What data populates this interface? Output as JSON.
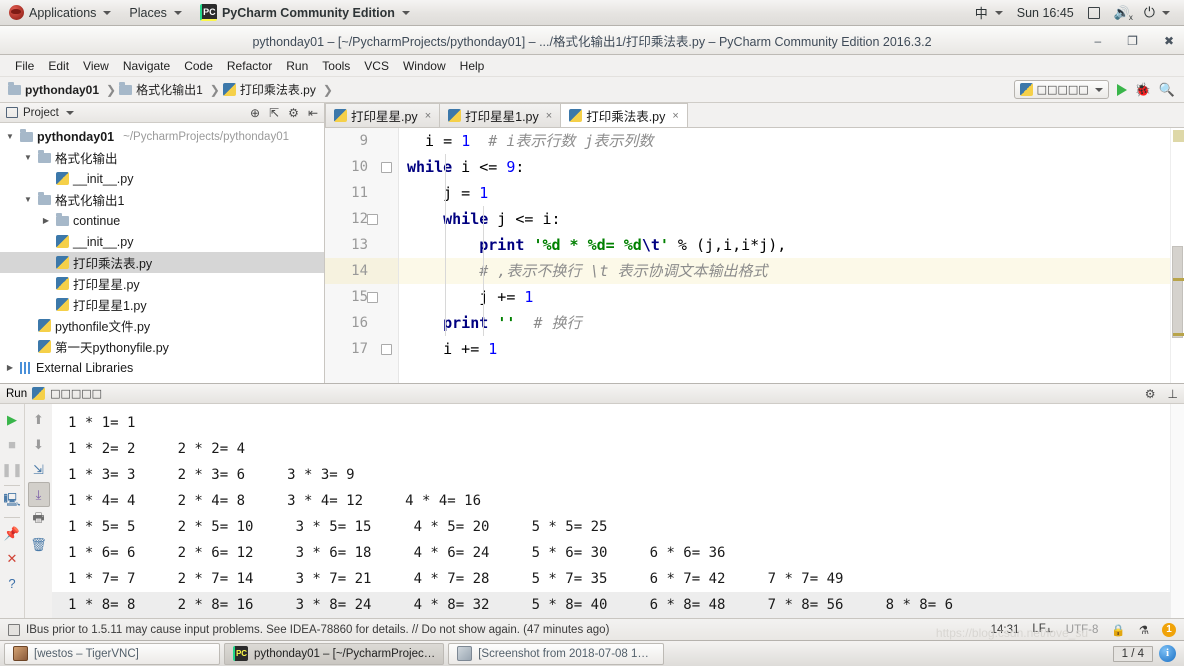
{
  "gnome_panel": {
    "applications": "Applications",
    "places": "Places",
    "app_name": "PyCharm Community Edition",
    "ime": "中",
    "clock": "Sun 16:45"
  },
  "window": {
    "title": "pythonday01 – [~/PycharmProjects/pythonday01] – .../格式化输出1/打印乘法表.py – PyCharm Community Edition 2016.3.2",
    "minimize": "–",
    "maximize": "❐",
    "close": "✖"
  },
  "menubar": {
    "items": [
      "File",
      "Edit",
      "View",
      "Navigate",
      "Code",
      "Refactor",
      "Run",
      "Tools",
      "VCS",
      "Window",
      "Help"
    ]
  },
  "navbar": {
    "breadcrumbs": [
      {
        "label": "pythonday01",
        "icon": "folder-icon"
      },
      {
        "label": "格式化输出1",
        "icon": "folder-icon"
      },
      {
        "label": "打印乘法表.py",
        "icon": "python-file-icon"
      }
    ],
    "run_config": "□□□□□",
    "run_button": "run-icon",
    "debug_button": "debug-icon",
    "search_button": "search-icon"
  },
  "sidebar": {
    "header": "Project",
    "tree": [
      {
        "label": "pythonday01",
        "path": "~/PycharmProjects/pythonday01",
        "icon": "folder-icon",
        "arrow": "▼",
        "indent": 0,
        "bold": true,
        "selected": false
      },
      {
        "label": "格式化输出",
        "path": "",
        "icon": "folder-icon",
        "arrow": "▼",
        "indent": 1,
        "bold": false,
        "selected": false
      },
      {
        "label": "__init__.py",
        "path": "",
        "icon": "python-file-icon",
        "arrow": "",
        "indent": 2,
        "bold": false,
        "selected": false
      },
      {
        "label": "格式化输出1",
        "path": "",
        "icon": "folder-icon",
        "arrow": "▼",
        "indent": 1,
        "bold": false,
        "selected": false
      },
      {
        "label": "continue",
        "path": "",
        "icon": "folder-icon",
        "arrow": "▶",
        "indent": 2,
        "bold": false,
        "selected": false
      },
      {
        "label": "__init__.py",
        "path": "",
        "icon": "python-file-icon",
        "arrow": "",
        "indent": 2,
        "bold": false,
        "selected": false
      },
      {
        "label": "打印乘法表.py",
        "path": "",
        "icon": "python-file-icon",
        "arrow": "",
        "indent": 2,
        "bold": false,
        "selected": true
      },
      {
        "label": "打印星星.py",
        "path": "",
        "icon": "python-file-icon",
        "arrow": "",
        "indent": 2,
        "bold": false,
        "selected": false
      },
      {
        "label": "打印星星1.py",
        "path": "",
        "icon": "python-file-icon",
        "arrow": "",
        "indent": 2,
        "bold": false,
        "selected": false
      },
      {
        "label": "pythonfile文件.py",
        "path": "",
        "icon": "python-file-icon",
        "arrow": "",
        "indent": 1,
        "bold": false,
        "selected": false
      },
      {
        "label": "第一天pythonyfile.py",
        "path": "",
        "icon": "python-file-icon",
        "arrow": "",
        "indent": 1,
        "bold": false,
        "selected": false
      },
      {
        "label": "External Libraries",
        "path": "",
        "icon": "library-icon",
        "arrow": "▶",
        "indent": 0,
        "bold": false,
        "selected": false
      }
    ]
  },
  "editor": {
    "tabs": [
      {
        "label": "打印星星.py",
        "active": false,
        "close": "×"
      },
      {
        "label": "打印星星1.py",
        "active": false,
        "close": "×"
      },
      {
        "label": "打印乘法表.py",
        "active": true,
        "close": "×"
      }
    ],
    "line_numbers": [
      "9",
      "10",
      "11",
      "12",
      "13",
      "14",
      "15",
      "16",
      "17"
    ],
    "code": [
      {
        "n": "9",
        "highlight": false,
        "tokens": [
          {
            "t": "  i = ",
            "c": ""
          },
          {
            "t": "1",
            "c": "num"
          },
          {
            "t": "  ",
            "c": ""
          },
          {
            "t": "# i表示行数 j表示列数",
            "c": "cmt"
          }
        ]
      },
      {
        "n": "10",
        "highlight": false,
        "tokens": [
          {
            "t": "while",
            "c": "kw"
          },
          {
            "t": " i <= ",
            "c": ""
          },
          {
            "t": "9",
            "c": "num"
          },
          {
            "t": ":",
            "c": ""
          }
        ]
      },
      {
        "n": "11",
        "highlight": false,
        "tokens": [
          {
            "t": "    j = ",
            "c": ""
          },
          {
            "t": "1",
            "c": "num"
          }
        ]
      },
      {
        "n": "12",
        "highlight": false,
        "tokens": [
          {
            "t": "    ",
            "c": ""
          },
          {
            "t": "while",
            "c": "kw"
          },
          {
            "t": " j <= i:",
            "c": ""
          }
        ]
      },
      {
        "n": "13",
        "highlight": false,
        "tokens": [
          {
            "t": "        ",
            "c": ""
          },
          {
            "t": "print",
            "c": "kw"
          },
          {
            "t": " ",
            "c": ""
          },
          {
            "t": "'%d * %d= %d",
            "c": "str"
          },
          {
            "t": "\\t",
            "c": "esc"
          },
          {
            "t": "'",
            "c": "str"
          },
          {
            "t": " % (j,i,i*j),",
            "c": ""
          }
        ]
      },
      {
        "n": "14",
        "highlight": true,
        "tokens": [
          {
            "t": "        ",
            "c": ""
          },
          {
            "t": "# ,表示不换行 \\t 表示协调文本输出格式",
            "c": "cmt"
          }
        ]
      },
      {
        "n": "15",
        "highlight": false,
        "tokens": [
          {
            "t": "        j += ",
            "c": ""
          },
          {
            "t": "1",
            "c": "num"
          }
        ]
      },
      {
        "n": "16",
        "highlight": false,
        "tokens": [
          {
            "t": "    ",
            "c": ""
          },
          {
            "t": "print",
            "c": "kw"
          },
          {
            "t": " ",
            "c": ""
          },
          {
            "t": "''",
            "c": "str"
          },
          {
            "t": "  ",
            "c": ""
          },
          {
            "t": "# 换行",
            "c": "cmt"
          }
        ]
      },
      {
        "n": "17",
        "highlight": false,
        "tokens": [
          {
            "t": "    i += ",
            "c": ""
          },
          {
            "t": "1",
            "c": "num"
          }
        ]
      }
    ]
  },
  "run_panel": {
    "tab_label": "Run",
    "tab_config": "□□□□□",
    "settings_icon": "gear-icon",
    "pin_icon": "minimize-icon",
    "tools_left": [
      "run-icon",
      "stop-icon",
      "pause-icon",
      "rerun-icon",
      "pin-icon",
      "close-icon",
      "help-icon"
    ],
    "tools_right": [
      "scroll-up-icon",
      "scroll-down-icon",
      "soft-wrap-icon",
      "scroll-to-end-icon",
      "print-icon",
      "clear-all-icon"
    ],
    "console_lines": [
      "1 * 1= 1",
      "1 * 2= 2     2 * 2= 4",
      "1 * 3= 3     2 * 3= 6     3 * 3= 9",
      "1 * 4= 4     2 * 4= 8     3 * 4= 12     4 * 4= 16",
      "1 * 5= 5     2 * 5= 10     3 * 5= 15     4 * 5= 20     5 * 5= 25",
      "1 * 6= 6     2 * 6= 12     3 * 6= 18     4 * 6= 24     5 * 6= 30     6 * 6= 36",
      "1 * 7= 7     2 * 7= 14     3 * 7= 21     4 * 7= 28     5 * 7= 35     6 * 7= 42     7 * 7= 49",
      "1 * 8= 8     2 * 8= 16     3 * 8= 24     4 * 8= 32     5 * 8= 40     6 * 8= 48     7 * 8= 56     8 * 8= 6"
    ]
  },
  "statusbar": {
    "message": "IBus prior to 1.5.11 may cause input problems. See IDEA-78860 for details. // Do not show again. (47 minutes ago)",
    "caret": "14:31",
    "line_sep": "LF⫠",
    "encoding": "UTF-8",
    "lock_icon": "lock-icon",
    "inspection_icon": "inspection-icon",
    "warning_count": "1"
  },
  "taskbar": {
    "tasks": [
      {
        "label": "[westos – TigerVNC]",
        "icon": "vnc-icon",
        "active": false
      },
      {
        "label": "pythonday01 – [~/PycharmProjec…",
        "icon": "pycharm-icon",
        "active": true
      },
      {
        "label": "[Screenshot from 2018-07-08 1…",
        "icon": "screenshot-icon",
        "active": false
      }
    ],
    "workspace": "1 / 4",
    "info_badge": "i",
    "watermark": "https://blog.csdn.net/love_su"
  }
}
